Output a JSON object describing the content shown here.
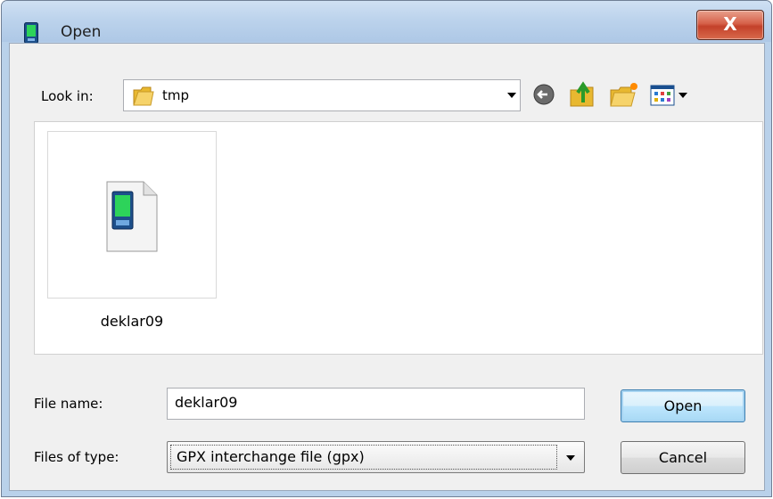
{
  "window": {
    "title": "Open",
    "close_label": "X"
  },
  "look_in": {
    "label": "Look in:",
    "value": "tmp"
  },
  "toolbar": [
    "back-icon",
    "up-folder-icon",
    "new-folder-icon",
    "view-menu-icon"
  ],
  "files": [
    {
      "name": "deklar09"
    }
  ],
  "file_name": {
    "label": "File name:",
    "value": "deklar09"
  },
  "file_type": {
    "label": "Files of type:",
    "value": "GPX interchange file (gpx)"
  },
  "buttons": {
    "open": "Open",
    "cancel": "Cancel"
  },
  "colors": {
    "title_bar": "#bcd3ec",
    "close_button": "#c3412a",
    "dialog_bg": "#f0f0f0",
    "default_button": "#bee6fd"
  }
}
